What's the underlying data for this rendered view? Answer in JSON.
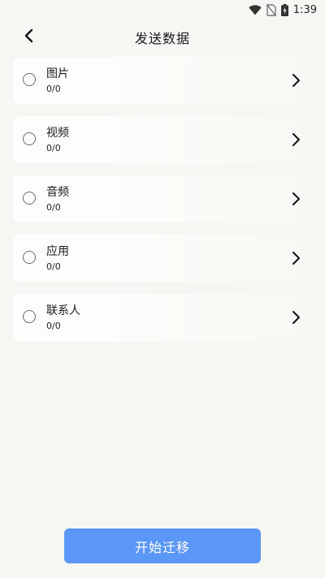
{
  "status_bar": {
    "time": "1:39",
    "icons": [
      "wifi-icon",
      "no-sim-icon",
      "battery-icon"
    ]
  },
  "header": {
    "title": "发送数据",
    "back_icon": "chevron-left-icon"
  },
  "categories": [
    {
      "id": "images",
      "label": "图片",
      "count": "0/0",
      "selected": false
    },
    {
      "id": "videos",
      "label": "视频",
      "count": "0/0",
      "selected": false
    },
    {
      "id": "audio",
      "label": "音频",
      "count": "0/0",
      "selected": false
    },
    {
      "id": "apps",
      "label": "应用",
      "count": "0/0",
      "selected": false
    },
    {
      "id": "contacts",
      "label": "联系人",
      "count": "0/0",
      "selected": false
    }
  ],
  "footer": {
    "start_label": "开始迁移"
  },
  "colors": {
    "background": "#f6f6f2",
    "card": "#fdfdfb",
    "accent": "#5b97f6",
    "radio_border": "#6b6b6b"
  }
}
